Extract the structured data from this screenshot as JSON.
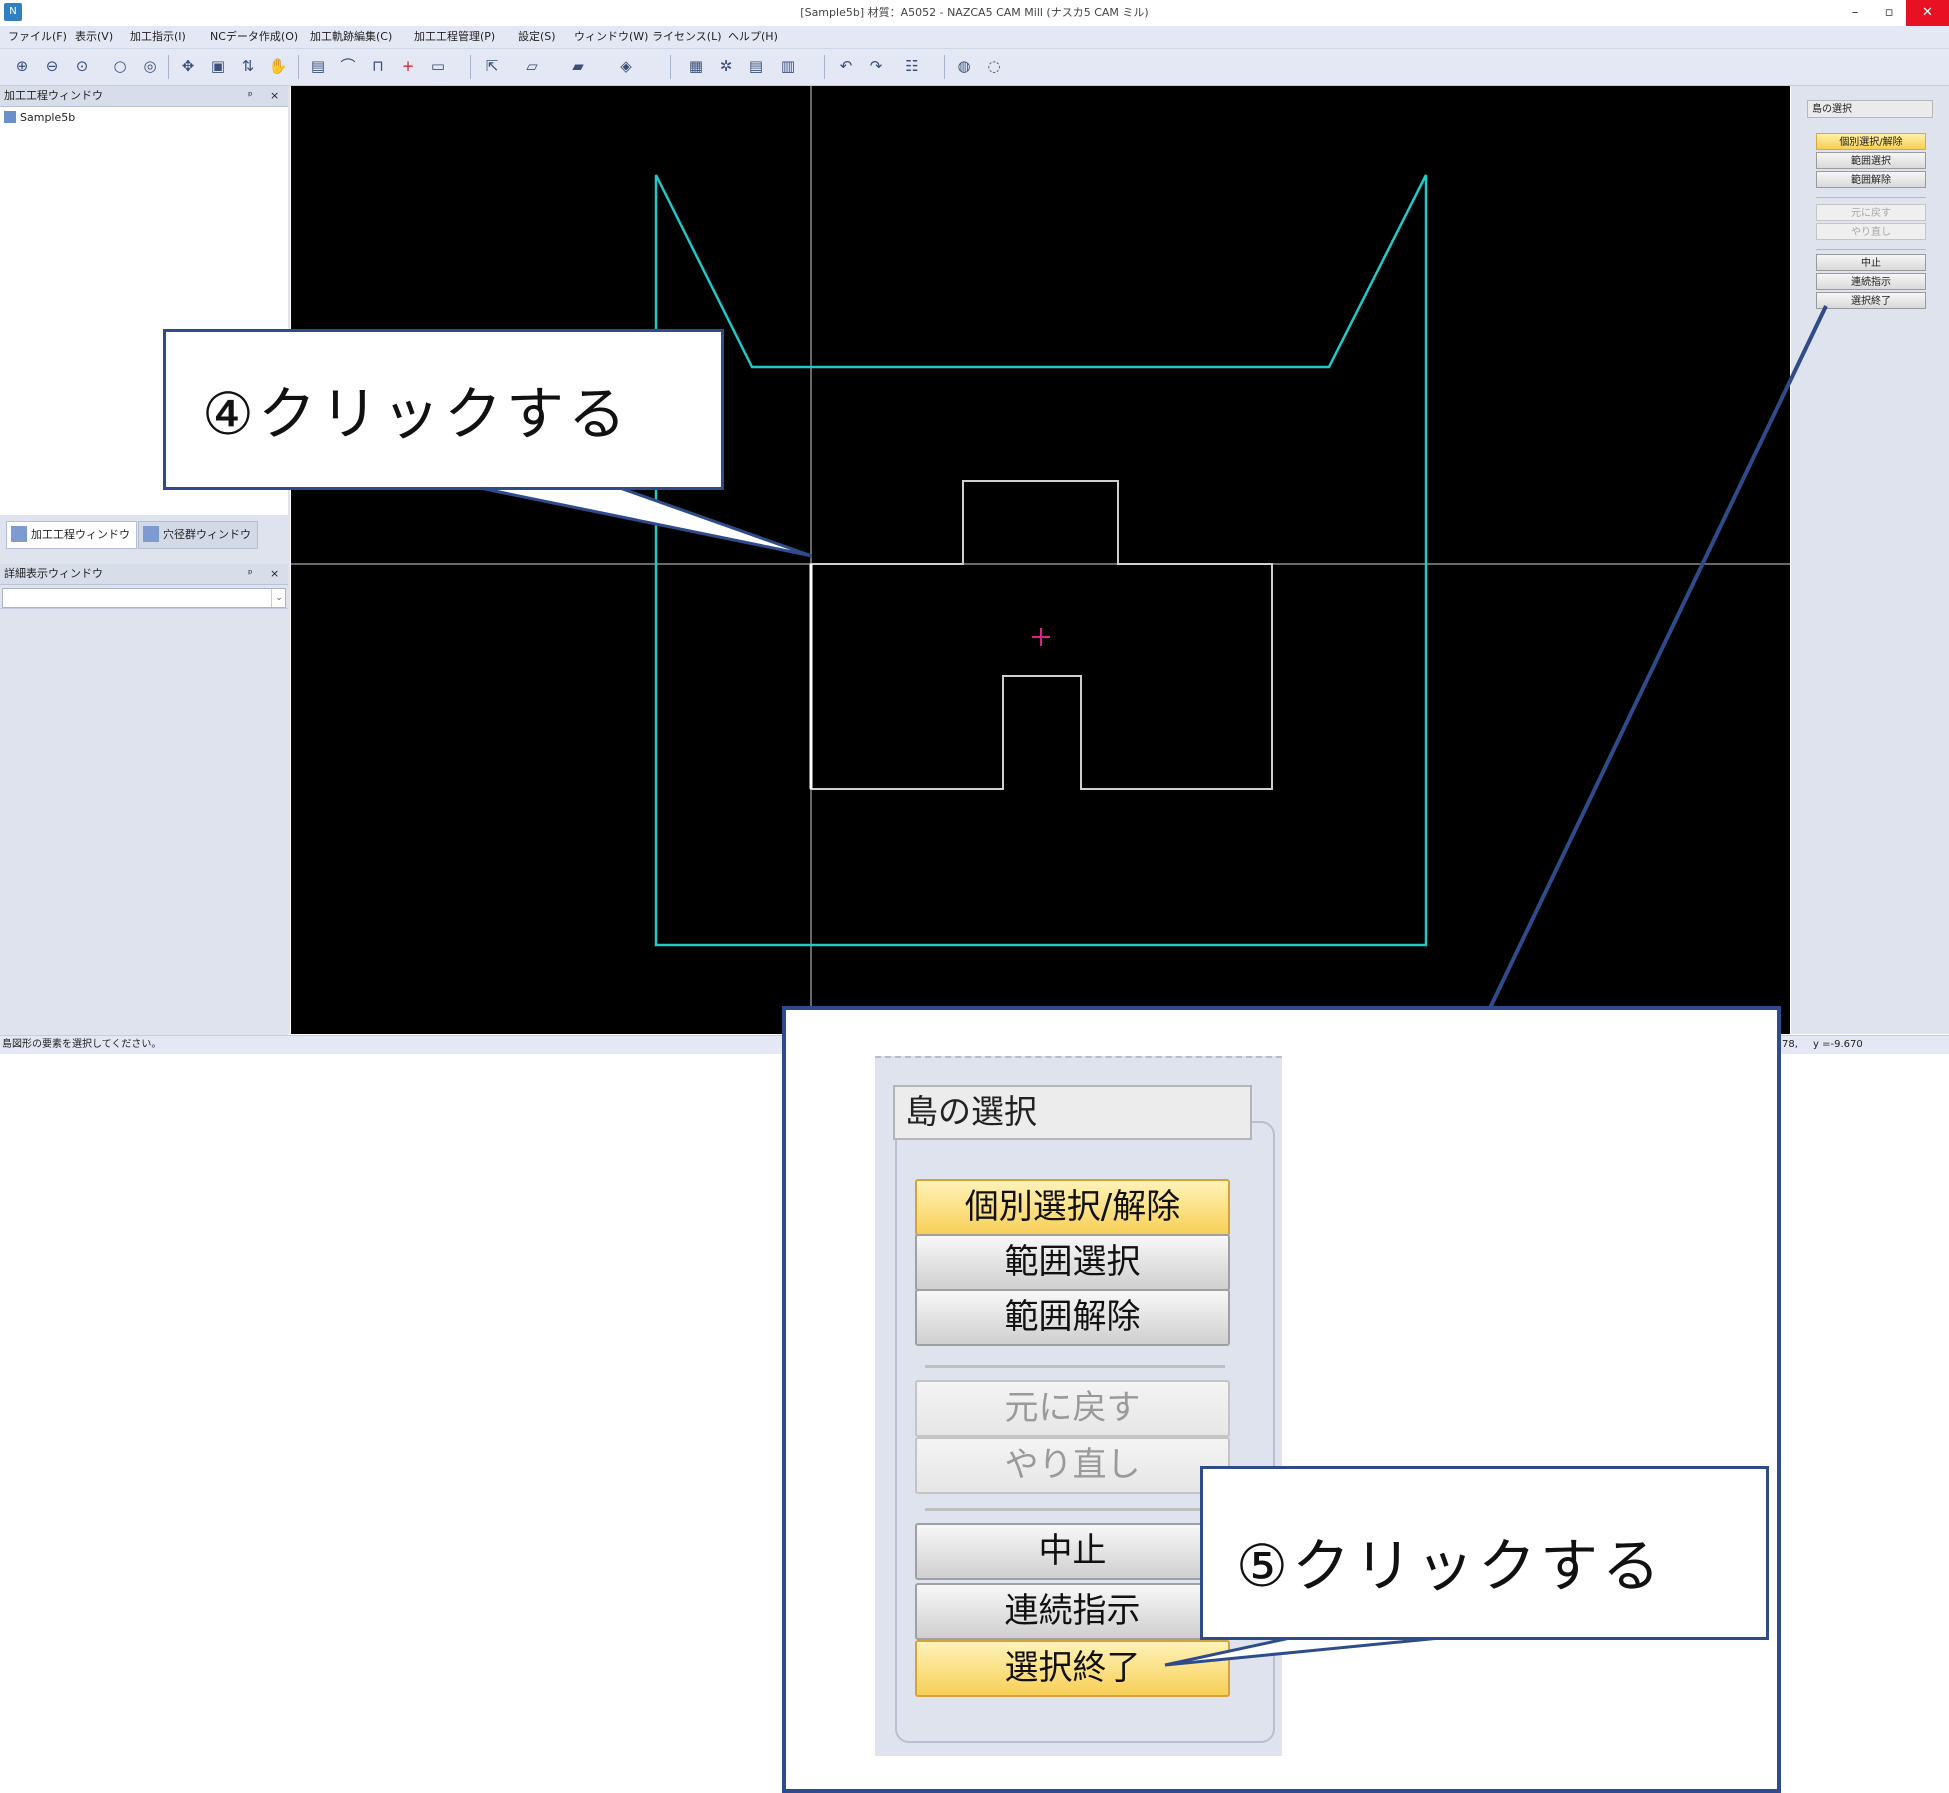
{
  "window": {
    "title": "[Sample5b] 材質：A5052 - NAZCA5 CAM Mill (ナスカ5 CAM ミル)",
    "minimize": "–",
    "maximize": "▫",
    "close": "✕"
  },
  "menu": [
    "ファイル(F)",
    "表示(V)",
    "加工指示(I)",
    "NCデータ作成(O)",
    "加工軌跡編集(C)",
    "加工工程管理(P)",
    "設定(S)",
    "ウィンドウ(W)",
    "ライセンス(L)",
    "ヘルプ(H)"
  ],
  "toolbar_icons": [
    "zoom-in-icon",
    "zoom-out-icon",
    "zoom-window-icon",
    "zoom-fit-icon",
    "zoom-previous-icon",
    "pan-icon",
    "redraw-icon",
    "rotate-icon",
    "hand-icon",
    "layer-icon",
    "tool-icon",
    "path-icon",
    "origin-plus-icon",
    "ruler-icon",
    "move-icon",
    "view-2d-icon",
    "view-25d-icon",
    "view-3d-icon",
    "chain-icon",
    "gear-icon",
    "nc-icon",
    "pst-icon",
    "undo-icon",
    "redo-icon",
    "settings-icon",
    "delete-icon",
    "eraser-icon"
  ],
  "left": {
    "process_window_title": "加工工程ウィンドウ",
    "pin": "ᵖ",
    "close": "×",
    "tree_item": "Sample5b",
    "tabs": [
      "加工工程ウィンドウ",
      "穴径群ウィンドウ"
    ],
    "detail_window_title": "詳細表示ウィンドウ",
    "combo_arrow": "⌄"
  },
  "right_panel": {
    "title": "島の選択",
    "group1": [
      "個別選択/解除",
      "範囲選択",
      "範囲解除"
    ],
    "group2": [
      "元に戻す",
      "やり直し"
    ],
    "group3": [
      "中止",
      "連続指示",
      "選択終了"
    ]
  },
  "status": {
    "message": "島図形の要素を選択してください。",
    "coord_x": "78,",
    "coord_y": "y =-9.670"
  },
  "callouts": {
    "step4": "④クリックする",
    "step5": "⑤クリックする"
  },
  "colors": {
    "accent_border": "#2e4b8a",
    "highlight_button": "#f6cf55",
    "stock_outline": "#21c9c9",
    "part_outline": "#cfcfcf",
    "origin_marker": "#e0208a"
  }
}
